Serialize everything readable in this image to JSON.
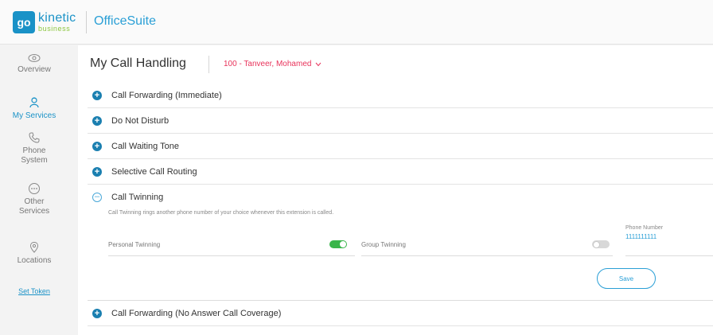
{
  "brand": {
    "go": "go",
    "kinetic": "kinetic",
    "business": "business",
    "app_title": "OfficeSuite"
  },
  "sidebar": {
    "items": [
      {
        "label": "Overview",
        "icon": "eye-icon"
      },
      {
        "label": "My Services",
        "icon": "user-services-icon",
        "active": true
      },
      {
        "label": "Phone System",
        "icon": "phone-icon"
      },
      {
        "label": "Other Services",
        "icon": "more-icon"
      },
      {
        "label": "Locations",
        "icon": "location-pin-icon"
      }
    ],
    "set_token": "Set Token"
  },
  "header": {
    "title": "My Call Handling",
    "user": "100 - Tanveer, Mohamed"
  },
  "sections": [
    {
      "label": "Call Forwarding (Immediate)",
      "expanded": false
    },
    {
      "label": "Do Not Disturb",
      "expanded": false
    },
    {
      "label": "Call Waiting Tone",
      "expanded": false
    },
    {
      "label": "Selective Call Routing",
      "expanded": false
    },
    {
      "label": "Call Twinning",
      "expanded": true
    },
    {
      "label": "Call Forwarding (No Answer Call Coverage)",
      "expanded": false
    }
  ],
  "twinning": {
    "description": "Call Twinning rings another phone number of your choice whenever this extension is called.",
    "personal_label": "Personal Twinning",
    "personal_on": true,
    "group_label": "Group Twinning",
    "group_on": false,
    "phone_label": "Phone Number",
    "phone_value": "1111111111",
    "save_label": "Save"
  },
  "colors": {
    "accent": "#1a92c7",
    "toggle_on": "#39b54a",
    "user_name": "#e8335b"
  }
}
